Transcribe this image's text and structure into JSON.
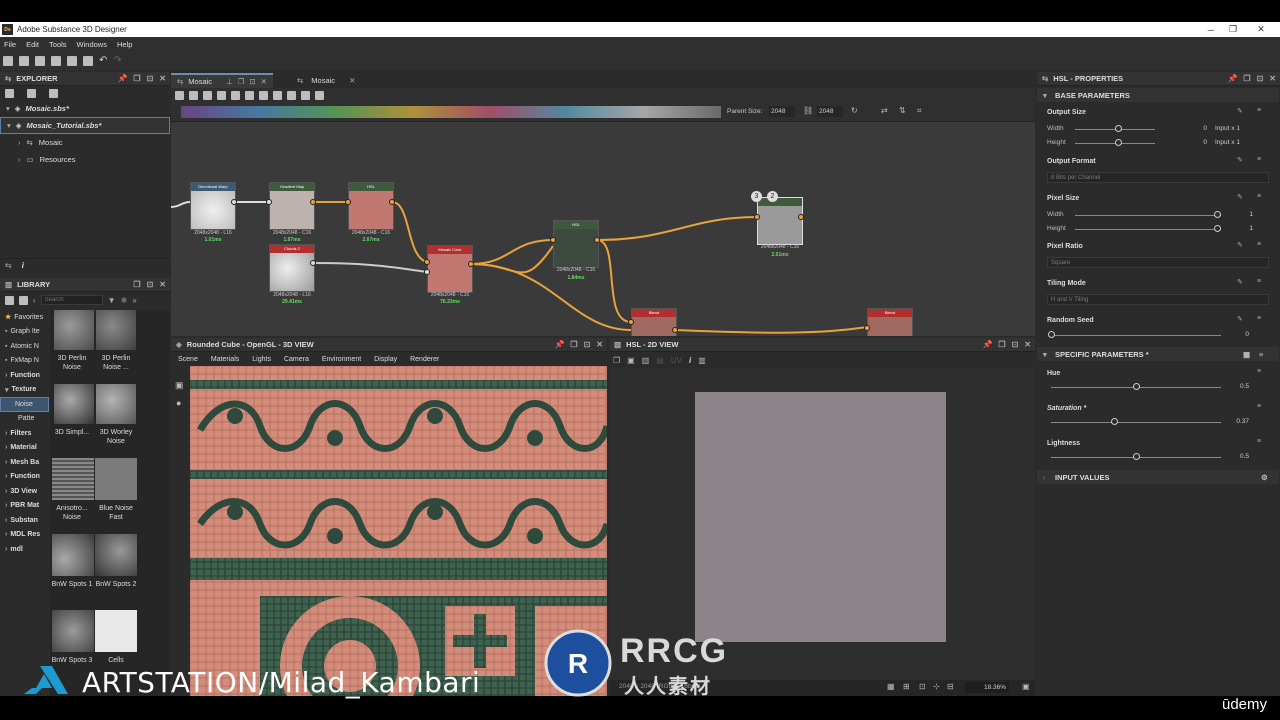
{
  "window": {
    "title": "Adobe Substance 3D Designer",
    "app_icon": "Ds"
  },
  "menu": [
    "File",
    "Edit",
    "Tools",
    "Windows",
    "Help"
  ],
  "explorer": {
    "title": "EXPLORER",
    "items": [
      {
        "label": "Mosaic.sbs*",
        "level": 0
      },
      {
        "label": "Mosaic_Tutorial.sbs*",
        "level": 0
      },
      {
        "label": "Mosaic",
        "level": 1
      },
      {
        "label": "Resources",
        "level": 1
      }
    ]
  },
  "library": {
    "title": "LIBRARY",
    "search_placeholder": "Search",
    "categories": [
      "Favorites",
      "Graph Ite",
      "Atomic N",
      "FxMap N",
      "Function",
      "Texture",
      "Noise",
      "Patte",
      "Filters",
      "Material",
      "Mesh Ba",
      "Function",
      "3D View",
      "PBR Mat",
      "Substan",
      "MDL Res",
      "mdl"
    ],
    "thumbs": [
      "3D Perlin Noise",
      "3D Perlin Noise ...",
      "3D Simpl...",
      "3D Worley Noise",
      "Anisotro... Noise",
      "Blue Noise Fast",
      "BnW Spots 1",
      "BnW Spots 2",
      "BnW Spots 3",
      "Cells"
    ]
  },
  "graph": {
    "tabs": [
      "Mosaic",
      "Mosaic"
    ],
    "parent_size_label": "Parent Size:",
    "parent_size_value": "2048",
    "size_value": "2048",
    "nodes": [
      {
        "title": "Directional Warp",
        "size": "2048x2048 - L16",
        "time": "1.01ms",
        "header": "#3b5a74",
        "body": "#d9d9d9"
      },
      {
        "title": "Gradient Map",
        "size": "2048x2048 - C16",
        "time": "1.97ms",
        "header": "#3d5a3d",
        "body": "#bdb2ad"
      },
      {
        "title": "HSL",
        "size": "2048x2048 - C16",
        "time": "2.67ms",
        "header": "#3d5a3d",
        "body": "#c07870"
      },
      {
        "title": "Clouds 2",
        "size": "2048x2048 - L16",
        "time": "29.41ms",
        "header": "#b03030",
        "body": "#cfcfcf"
      },
      {
        "title": "Mosaic Color",
        "size": "2048x2048 - C16",
        "time": "76.23ms",
        "header": "#b03030",
        "body": "#c07870"
      },
      {
        "title": "HSL",
        "size": "2048x2048 - C16",
        "time": "1.84ms",
        "header": "#3d5a3d",
        "body": "#3e4a40"
      },
      {
        "title": "",
        "size": "2048x2048 - C16",
        "time": "2.01ms",
        "header": "#3d5a3d",
        "body": "#9a9a9a"
      },
      {
        "title": "Blend",
        "size": "",
        "time": "",
        "header": "#b03030",
        "body": "#a06a60"
      },
      {
        "title": "Blend",
        "size": "",
        "time": "",
        "header": "#b03030",
        "body": "#a06a60"
      }
    ]
  },
  "view3d": {
    "title": "Rounded Cube - OpenGL - 3D VIEW",
    "menu": [
      "Scene",
      "Materials",
      "Lights",
      "Camera",
      "Environment",
      "Display",
      "Renderer"
    ]
  },
  "view2d": {
    "title": "HSL - 2D VIEW",
    "status": "2048 x 2048 (RGBA, 16bpc)",
    "zoom": "18.36%",
    "image_color": "#8d8489"
  },
  "properties": {
    "title": "HSL - PROPERTIES",
    "base_header": "BASE PARAMETERS",
    "output_size": {
      "label": "Output Size",
      "width_label": "Width",
      "height_label": "Height",
      "width_value": "0",
      "height_value": "0",
      "width_mode": "Input x 1",
      "height_mode": "Input x 1"
    },
    "output_format": {
      "label": "Output Format",
      "value": "8 Bits per Channel"
    },
    "pixel_size": {
      "label": "Pixel Size",
      "width_label": "Width",
      "height_label": "Height",
      "width_value": "1",
      "height_value": "1"
    },
    "pixel_ratio": {
      "label": "Pixel Ratio",
      "value": "Square"
    },
    "tiling_mode": {
      "label": "Tiling Mode",
      "value": "H and V Tiling"
    },
    "random_seed": {
      "label": "Random Seed",
      "value": "0"
    },
    "specific_header": "SPECIFIC PARAMETERS *",
    "hue": {
      "label": "Hue",
      "value": "0.5",
      "level": 0.5
    },
    "saturation": {
      "label": "Saturation *",
      "value": "0.37",
      "level": 0.37
    },
    "lightness": {
      "label": "Lightness",
      "value": "0.5",
      "level": 0.5
    },
    "input_header": "INPUT VALUES"
  },
  "watermarks": {
    "artstation": "ARTSTATION/Milad_Kambari",
    "rrcg_top": "RRCG",
    "rrcg_bottom": "人人素材",
    "udemy": "ūdemy"
  }
}
